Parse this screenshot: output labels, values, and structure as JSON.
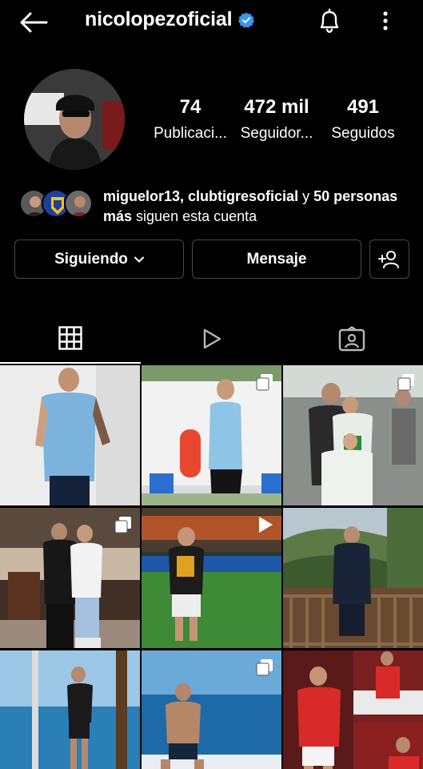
{
  "header": {
    "username": "nicolopezoficial"
  },
  "stats": {
    "posts_count": "74",
    "posts_label": "Publicaci...",
    "followers_count": "472 mil",
    "followers_label": "Seguidor...",
    "following_count": "491",
    "following_label": "Seguidos"
  },
  "mutual": {
    "names": "miguelor13, clubtigresoficial",
    "connector": " y ",
    "others": "50 personas más",
    "suffix": " siguen esta cuenta"
  },
  "actions": {
    "follow_label": "Siguiendo",
    "message_label": "Mensaje"
  },
  "tabs": [
    {
      "icon": "grid-icon",
      "active": true
    },
    {
      "icon": "reels-icon",
      "active": false
    },
    {
      "icon": "tagged-icon",
      "active": false
    }
  ],
  "posts": [
    {
      "type": "image",
      "badge": null
    },
    {
      "type": "carousel",
      "badge": "carousel-icon"
    },
    {
      "type": "carousel",
      "badge": "carousel-icon"
    },
    {
      "type": "carousel",
      "badge": "carousel-icon"
    },
    {
      "type": "video",
      "badge": "play-icon"
    },
    {
      "type": "image",
      "badge": null
    },
    {
      "type": "image",
      "badge": null
    },
    {
      "type": "carousel",
      "badge": "carousel-icon"
    },
    {
      "type": "image",
      "badge": null
    }
  ],
  "colors": {
    "background": "#000000",
    "verified": "#3897f0",
    "button_border": "#4a4a4a"
  }
}
